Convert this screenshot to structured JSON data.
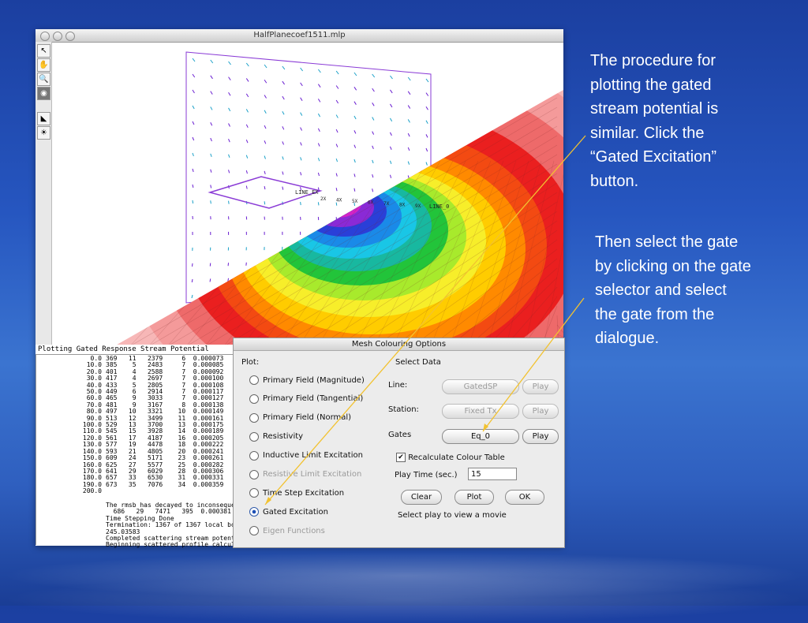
{
  "window": {
    "title": "HalfPlanecoef1511.mlp"
  },
  "plot": {
    "labels": {
      "line_ex": "LINE_EX",
      "line_0": "LINE_0",
      "station_marks": [
        "2X",
        "4X",
        "5X",
        "6X",
        "7X",
        "8X",
        "9X"
      ]
    }
  },
  "console": {
    "title": "Plotting Gated Response Stream Potential",
    "numbers": [
      "0.0",
      "10.0",
      "20.0",
      "30.0",
      "40.0",
      "50.0",
      "60.0",
      "70.0",
      "80.0",
      "90.0",
      "100.0",
      "110.0",
      "120.0",
      "130.0",
      "140.0",
      "150.0",
      "160.0",
      "170.0",
      "180.0",
      "190.0",
      "200.0"
    ],
    "rows": [
      "369   11   2379     6  0.000073",
      "385    5   2483     7  0.000085",
      "401    4   2588     7  0.000092",
      "417    4   2697     7  0.000100",
      "433    5   2805     7  0.000108",
      "449    6   2914     7  0.000117",
      "465    9   3033     7  0.000127",
      "481    9   3167     8  0.000138",
      "497   10   3321    10  0.000149",
      "513   12   3499    11  0.000161",
      "529   13   3700    13  0.000175",
      "545   15   3928    14  0.000189",
      "561   17   4187    16  0.000205",
      "577   19   4478    18  0.000222",
      "593   21   4805    20  0.000241",
      "609   24   5171    23  0.000261",
      "625   27   5577    25  0.000282",
      "641   29   6029    28  0.000306",
      "657   33   6530    31  0.000331",
      "673   35   7076    34  0.000359"
    ],
    "logs": [
      "The rmsb has decayed to inconseque",
      "  686   29   7471   395  0.000381",
      "Time Stepping Done",
      "Termination: 1367 of 1367 local bo",
      "245.03583",
      "Completed scattering stream potent",
      "Beginning scattered profile calcul"
    ]
  },
  "dialog": {
    "title": "Mesh Colouring Options",
    "plot_label": "Plot:",
    "select_data_label": "Select  Data",
    "options": [
      {
        "label": "Primary Field (Magnitude)",
        "selected": false,
        "enabled": true
      },
      {
        "label": "Primary Field (Tangential)",
        "selected": false,
        "enabled": true
      },
      {
        "label": "Primary Field (Normal)",
        "selected": false,
        "enabled": true
      },
      {
        "label": "Resistivity",
        "selected": false,
        "enabled": true
      },
      {
        "label": "Inductive Limit Excitation",
        "selected": false,
        "enabled": true
      },
      {
        "label": "Resistive Limit Excitation",
        "selected": false,
        "enabled": false
      },
      {
        "label": "Time Step Excitation",
        "selected": false,
        "enabled": true
      },
      {
        "label": "Gated Excitation",
        "selected": true,
        "enabled": true
      },
      {
        "label": "Eigen Functions",
        "selected": false,
        "enabled": false
      }
    ],
    "line": {
      "label": "Line:",
      "value": "GatedSP",
      "play": "Play"
    },
    "station": {
      "label": "Station:",
      "value": "Fixed Tx",
      "play": "Play"
    },
    "gates": {
      "label": "Gates",
      "value": "Eq_0",
      "play": "Play"
    },
    "recalc": {
      "label": "Recalculate Colour Table",
      "checked": true
    },
    "play_time": {
      "label": "Play Time (sec.)",
      "value": "15"
    },
    "buttons": {
      "clear": "Clear",
      "plot": "Plot",
      "ok": "OK"
    },
    "hint": "Select play to view a movie"
  },
  "captions": {
    "first": [
      "The procedure for",
      "plotting the gated",
      "stream potential is",
      "similar.  Click the",
      "“Gated Excitation”",
      "button."
    ],
    "second": [
      "Then select the gate",
      "by clicking on the gate",
      "selector and select",
      "the gate from the",
      "dialogue."
    ]
  },
  "colors": {
    "arrow": "#f2c230",
    "vector": "#6a1fd1"
  }
}
